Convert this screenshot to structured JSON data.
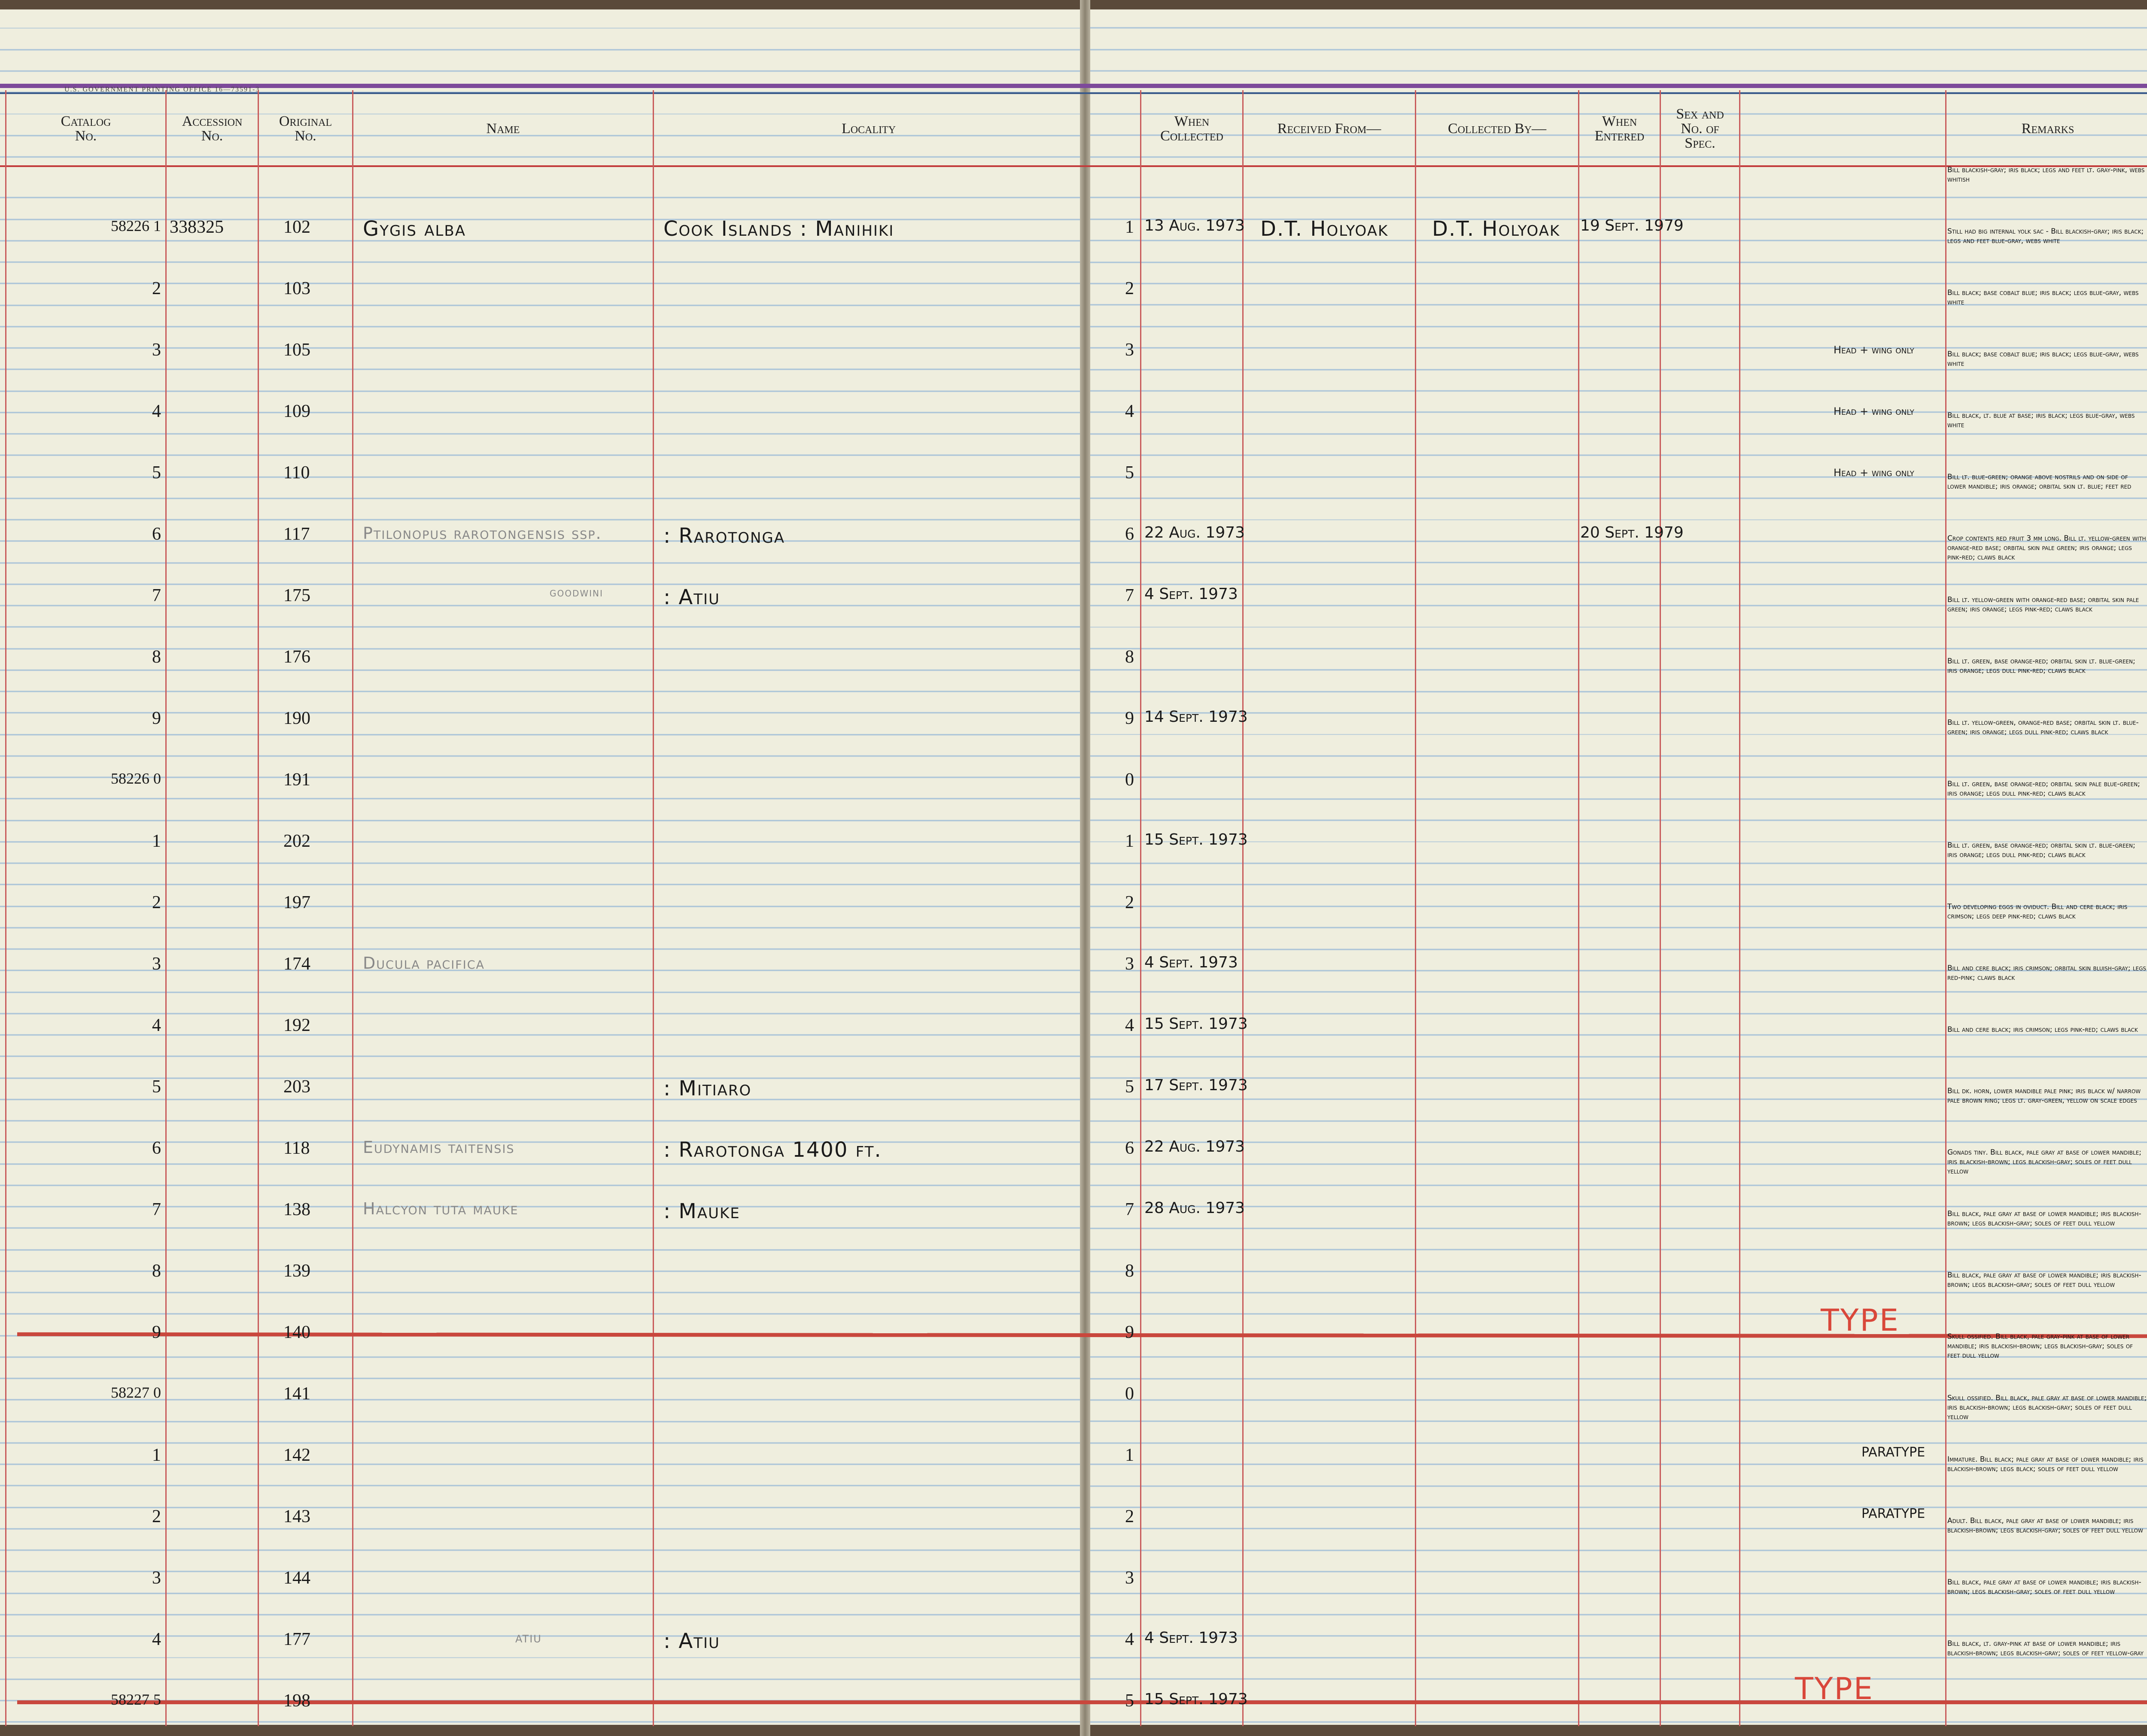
{
  "header": {
    "gpo": "U.S. GOVERNMENT PRINTING OFFICE    16—73591-3",
    "catalog": "Catalog\nNo.",
    "accession": "Accession\nNo.",
    "original": "Original\nNo.",
    "name": "Name",
    "locality": "Locality",
    "when_collected": "When\nCollected",
    "received_from": "Received From—",
    "collected_by": "Collected By—",
    "when_entered": "When\nEntered",
    "sex": "Sex and\nNo. of\nSpec.",
    "remarks": "Remarks"
  },
  "rows": [
    {
      "cat": "58226 1",
      "acc": "338325",
      "orig": "102",
      "name": "Gygis alba",
      "loc": "Cook Islands : Manihiki",
      "idx": "1",
      "date": "13 Aug. 1973",
      "recv": "D.T. Holyoak",
      "coll": "D.T. Holyoak",
      "entered": "19 Sept. 1979",
      "sex": "—",
      "note": "",
      "remark": "Bill blackish-gray; iris black; legs and feet lt. gray-pink, webs whitish"
    },
    {
      "cat": "2",
      "acc": "",
      "orig": "103",
      "name": "",
      "loc": "",
      "idx": "2",
      "date": "",
      "recv": "",
      "coll": "",
      "entered": "",
      "sex": "—",
      "note": "",
      "remark": "Still had big internal yolk sac - Bill blackish-gray; iris black; legs and feet blue-gray, webs white"
    },
    {
      "cat": "3",
      "acc": "",
      "orig": "105",
      "name": "",
      "loc": "",
      "idx": "3",
      "date": "",
      "recv": "",
      "coll": "",
      "entered": "",
      "sex": "♀",
      "note": "Head + wing only",
      "remark": "Bill black; base cobalt blue; iris black; legs blue-gray, webs white"
    },
    {
      "cat": "4",
      "acc": "",
      "orig": "109",
      "name": "",
      "loc": "",
      "idx": "4",
      "date": "",
      "recv": "",
      "coll": "",
      "entered": "",
      "sex": "♂",
      "note": "Head + wing only",
      "remark": "Bill black; base cobalt blue; iris black; legs blue-gray, webs white"
    },
    {
      "cat": "5",
      "acc": "",
      "orig": "110",
      "name": "",
      "loc": "",
      "idx": "5",
      "date": "",
      "recv": "",
      "coll": "",
      "entered": "",
      "sex": "♂",
      "note": "Head + wing only",
      "remark": "Bill black, lt. blue at base; iris black; legs blue-gray, webs white"
    },
    {
      "cat": "6",
      "acc": "",
      "orig": "117",
      "name": "Ptilonopus rarotongensis ssp.",
      "loc": ": Rarotonga",
      "idx": "6",
      "date": "22 Aug. 1973",
      "recv": "",
      "coll": "",
      "entered": "20 Sept. 1979",
      "sex": "—",
      "note": "",
      "remark": "Bill lt. blue-green; orange above nostrils and on side of lower mandible; iris orange; orbital skin lt. blue; feet red"
    },
    {
      "cat": "7",
      "acc": "",
      "orig": "175",
      "name": "goodwini",
      "loc": ": Atiu",
      "idx": "7",
      "date": "4 Sept. 1973",
      "recv": "",
      "coll": "",
      "entered": "",
      "sex": "♂",
      "note": "",
      "remark": "Crop contents red fruit 3 mm long. Bill lt. yellow-green with orange-red base; orbital skin pale green; iris orange; legs pink-red; claws black"
    },
    {
      "cat": "8",
      "acc": "",
      "orig": "176",
      "name": "",
      "loc": "",
      "idx": "8",
      "date": "",
      "recv": "",
      "coll": "",
      "entered": "",
      "sex": "♂",
      "note": "",
      "remark": "Bill lt. yellow-green with orange-red base; orbital skin pale green; iris orange; legs pink-red; claws black"
    },
    {
      "cat": "9",
      "acc": "",
      "orig": "190",
      "name": "",
      "loc": "",
      "idx": "9",
      "date": "14 Sept. 1973",
      "recv": "",
      "coll": "",
      "entered": "",
      "sex": "♀",
      "note": "",
      "remark": "Bill lt. green, base orange-red; orbital skin lt. blue-green; iris orange; legs dull pink-red; claws black"
    },
    {
      "cat": "58226 0",
      "acc": "",
      "orig": "191",
      "name": "",
      "loc": "",
      "idx": "0",
      "date": "",
      "recv": "",
      "coll": "",
      "entered": "",
      "sex": "—",
      "note": "",
      "remark": "Bill lt. yellow-green, orange-red base; orbital skin lt. blue-green; iris orange; legs dull pink-red; claws black"
    },
    {
      "cat": "1",
      "acc": "",
      "orig": "202",
      "name": "",
      "loc": "",
      "idx": "1",
      "date": "15 Sept. 1973",
      "recv": "",
      "coll": "",
      "entered": "",
      "sex": "♂",
      "note": "",
      "remark": "Bill lt. green, base orange-red; orbital skin pale blue-green; iris orange; legs dull pink-red; claws black"
    },
    {
      "cat": "2",
      "acc": "",
      "orig": "197",
      "name": "",
      "loc": "",
      "idx": "2",
      "date": "",
      "recv": "",
      "coll": "",
      "entered": "",
      "sex": "♀",
      "note": "",
      "remark": "Bill lt. green, base orange-red; orbital skin lt. blue-green; iris orange; legs dull pink-red; claws black"
    },
    {
      "cat": "3",
      "acc": "",
      "orig": "174",
      "name": "Ducula pacifica",
      "loc": "",
      "idx": "3",
      "date": "4 Sept. 1973",
      "recv": "",
      "coll": "",
      "entered": "",
      "sex": "♀",
      "note": "",
      "remark": "Two developing eggs in oviduct. Bill and cere black; iris crimson; legs deep pink-red; claws black"
    },
    {
      "cat": "4",
      "acc": "",
      "orig": "192",
      "name": "",
      "loc": "",
      "idx": "4",
      "date": "15 Sept. 1973",
      "recv": "",
      "coll": "",
      "entered": "",
      "sex": "♂",
      "note": "",
      "remark": "Bill and cere black; iris crimson; orbital skin bluish-gray; legs red-pink; claws black"
    },
    {
      "cat": "5",
      "acc": "",
      "orig": "203",
      "name": "",
      "loc": ": Mitiaro",
      "idx": "5",
      "date": "17 Sept. 1973",
      "recv": "",
      "coll": "",
      "entered": "",
      "sex": "♀",
      "note": "",
      "remark": "Bill and cere black; iris crimson; legs pink-red; claws black"
    },
    {
      "cat": "6",
      "acc": "",
      "orig": "118",
      "name": "Eudynamis taitensis",
      "loc": ": Rarotonga     1400 ft.",
      "idx": "6",
      "date": "22 Aug. 1973",
      "recv": "",
      "coll": "",
      "entered": "",
      "sex": "—",
      "note": "",
      "remark": "Bill dk. horn, lower mandible pale pink; iris black w/ narrow pale brown ring; legs lt. gray-green, yellow on scale edges"
    },
    {
      "cat": "7",
      "acc": "",
      "orig": "138",
      "name": "Halcyon tuta mauke",
      "loc": ": Mauke",
      "idx": "7",
      "date": "28 Aug. 1973",
      "recv": "",
      "coll": "",
      "entered": "",
      "sex": "♀",
      "note": "",
      "remark": "Gonads tiny. Bill black, pale gray at base of lower mandible; iris blackish-brown; legs blackish-gray; soles of feet dull yellow"
    },
    {
      "cat": "8",
      "acc": "",
      "orig": "139",
      "name": "",
      "loc": "",
      "idx": "8",
      "date": "",
      "recv": "",
      "coll": "",
      "entered": "",
      "sex": "♂",
      "note": "",
      "remark": "Bill black, pale gray at base of lower mandible; iris blackish-brown; legs blackish-gray; soles of feet dull yellow"
    },
    {
      "cat": "9",
      "acc": "",
      "orig": "140",
      "name": "",
      "loc": "",
      "idx": "9",
      "date": "",
      "recv": "",
      "coll": "",
      "entered": "",
      "sex": "♀",
      "note": "TYPE",
      "remark": "Bill black, pale gray at base of lower mandible; iris blackish-brown; legs blackish-gray; soles of feet dull yellow"
    },
    {
      "cat": "58227 0",
      "acc": "",
      "orig": "141",
      "name": "",
      "loc": "",
      "idx": "0",
      "date": "",
      "recv": "",
      "coll": "",
      "entered": "",
      "sex": "♂",
      "note": "",
      "remark": "Skull ossified. Bill black, pale gray-pink at base of lower mandible; iris blackish-brown; legs blackish-gray; soles of feet dull yellow"
    },
    {
      "cat": "1",
      "acc": "",
      "orig": "142",
      "name": "",
      "loc": "",
      "idx": "1",
      "date": "",
      "recv": "",
      "coll": "",
      "entered": "",
      "sex": "♂",
      "note": "PARATYPE",
      "remark": "Skull ossified. Bill black, pale gray at base of lower mandible; iris blackish-brown; legs blackish-gray; soles of feet dull yellow"
    },
    {
      "cat": "2",
      "acc": "",
      "orig": "143",
      "name": "",
      "loc": "",
      "idx": "2",
      "date": "",
      "recv": "",
      "coll": "",
      "entered": "",
      "sex": "♀",
      "note": "PARATYPE",
      "remark": "Immature. Bill black; pale gray at base of lower mandible; iris blackish-brown; legs black; soles of feet dull yellow"
    },
    {
      "cat": "3",
      "acc": "",
      "orig": "144",
      "name": "",
      "loc": "",
      "idx": "3",
      "date": "",
      "recv": "",
      "coll": "",
      "entered": "",
      "sex": "♀",
      "note": "",
      "remark": "Adult. Bill black, pale gray at base of lower mandible; iris blackish-brown; legs blackish-gray; soles of feet dull yellow"
    },
    {
      "cat": "4",
      "acc": "",
      "orig": "177",
      "name": "atiu",
      "loc": ": Atiu",
      "idx": "4",
      "date": "4 Sept. 1973",
      "recv": "",
      "coll": "",
      "entered": "",
      "sex": "♀",
      "note": "",
      "remark": "Bill black, pale gray at base of lower mandible; iris blackish-brown; legs blackish-gray; soles of feet dull yellow"
    },
    {
      "cat": "58227 5",
      "acc": "",
      "orig": "198",
      "name": "",
      "loc": "",
      "idx": "5",
      "date": "15 Sept. 1973",
      "recv": "",
      "coll": "",
      "entered": "",
      "sex": "♂",
      "note": "TYPE",
      "remark": "Bill black, lt. gray-pink at base of lower mandible; iris blackish-brown; legs blackish-gray; soles of feet yellow-gray"
    }
  ],
  "colors": {
    "rule_red": "#c9473d",
    "ink": "#1a1a1a",
    "type_red": "#d9473a",
    "paper": "#efeede"
  }
}
